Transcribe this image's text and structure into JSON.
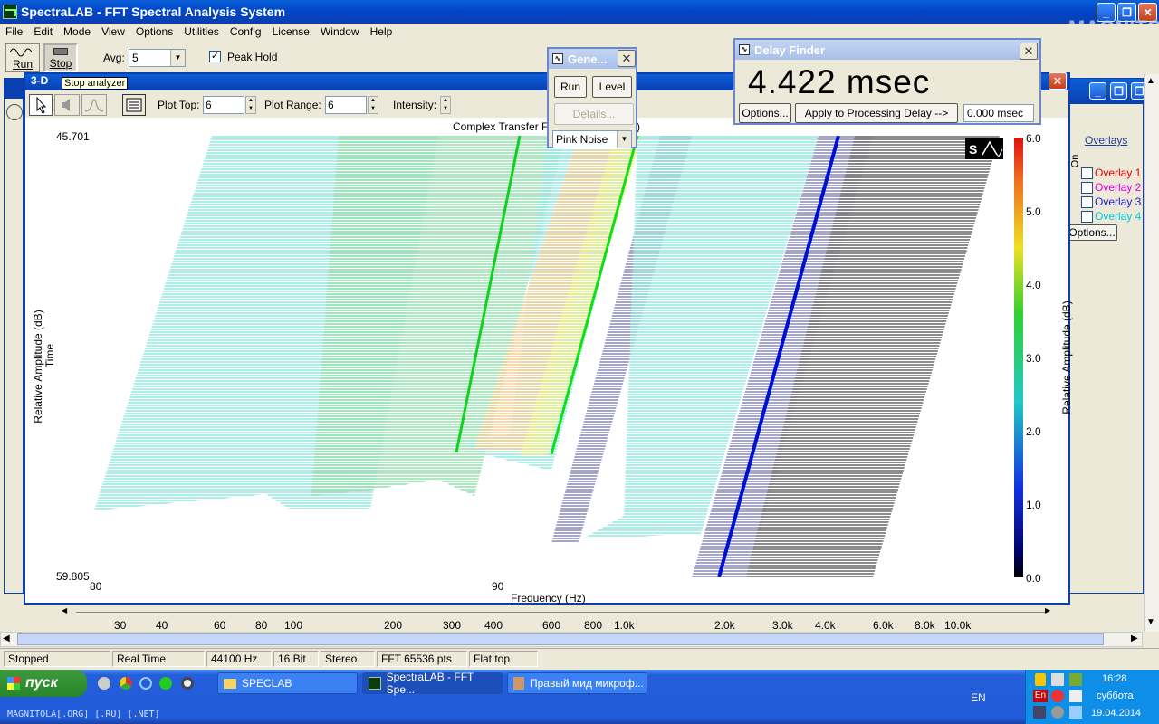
{
  "app": {
    "title": "SpectraLAB - FFT Spectral Analysis System"
  },
  "menu": [
    "File",
    "Edit",
    "Mode",
    "View",
    "Options",
    "Utilities",
    "Config",
    "License",
    "Window",
    "Help"
  ],
  "toolbar": {
    "run_label": "Run",
    "stop_label": "Stop",
    "stop_tooltip": "Stop analyzer",
    "avg_label": "Avg:",
    "avg_value": "5",
    "peak_hold_label": "Peak Hold",
    "peak_hold_checked": true
  },
  "watermark": "MAGNITOLA",
  "plot_window": {
    "title": "3-D",
    "plot_top_label": "Plot Top:",
    "plot_top_value": "6",
    "plot_range_label": "Plot Range:",
    "plot_range_value": "6",
    "intensity_label": "Intensity:",
    "plot_title": "Complex Transfer F",
    "plot_title_end": ")",
    "y_axis_label": "Relative Amplitude (dB)",
    "time_label": "Time",
    "y_top": "45.701",
    "y_bottom": "59.805",
    "x_axis_label": "Frequency (Hz)",
    "x_tick_left": "80",
    "x_tick_mid": "90",
    "colorbar_label": "Relative Amplitude (dB)",
    "colorbar_ticks": [
      "6.0",
      "5.0",
      "4.0",
      "3.0",
      "2.0",
      "1.0",
      "0.0"
    ]
  },
  "generator": {
    "title": "Gene...",
    "run_label": "Run",
    "level_label": "Level",
    "details_label": "Details...",
    "signal": "Pink Noise"
  },
  "delay_finder": {
    "title": "Delay Finder",
    "value": "4.422 msec",
    "options_label": "Options...",
    "apply_label": "Apply to Processing Delay -->",
    "processing_delay": "0.000 msec"
  },
  "overlays": {
    "header": "Overlays",
    "on_label": "On",
    "items": [
      {
        "label": "Overlay 1",
        "color": "#e00000"
      },
      {
        "label": "Overlay 2",
        "color": "#e000e0"
      },
      {
        "label": "Overlay 3",
        "color": "#2020c0"
      },
      {
        "label": "Overlay 4",
        "color": "#00c8e0"
      }
    ],
    "options_label": "Options..."
  },
  "freq_ruler": [
    "30",
    "40",
    "60",
    "80",
    "100",
    "200",
    "300",
    "400",
    "600",
    "800",
    "1.0k",
    "2.0k",
    "3.0k",
    "4.0k",
    "6.0k",
    "8.0k",
    "10.0k"
  ],
  "status": [
    "Stopped",
    "Real Time",
    "44100 Hz",
    "16 Bit",
    "Stereo",
    "FFT 65536 pts",
    "Flat top"
  ],
  "taskbar": {
    "start_label": "пуск",
    "tasks": [
      "SPECLAB",
      "SpectraLAB - FFT Spe...",
      "Правый мид микроф..."
    ],
    "lang": "EN",
    "tray_lang": "En",
    "time": "16:28",
    "day": "суббота",
    "date": "19.04.2014",
    "footer": "MAGNITOLA[.ORG] [.RU] [.NET]"
  }
}
